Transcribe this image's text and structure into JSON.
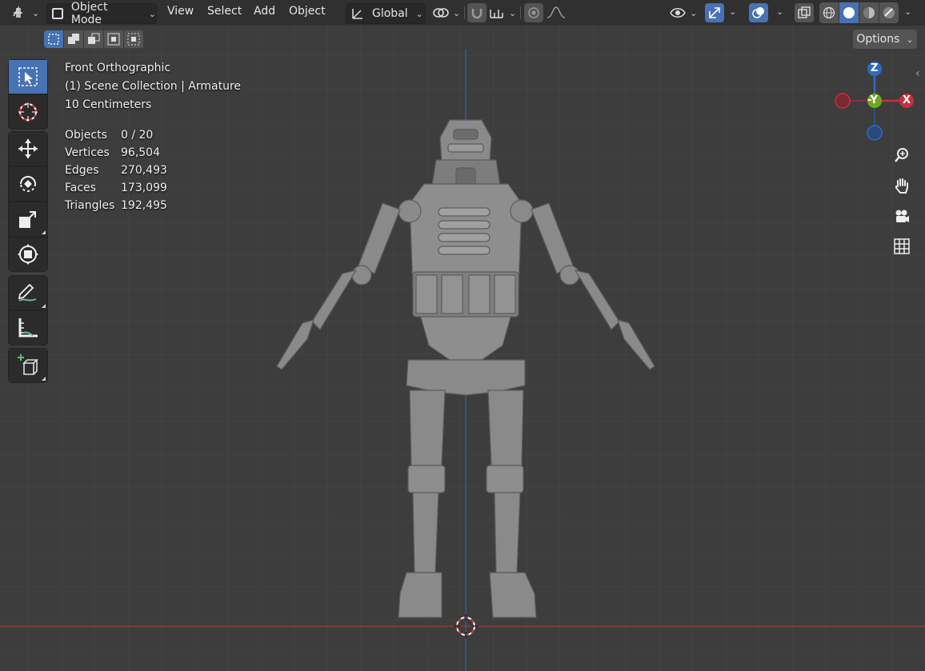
{
  "header": {
    "mode_label": "Object Mode",
    "menus": [
      "View",
      "Select",
      "Add",
      "Object"
    ],
    "transform_orientation": "Global",
    "options_label": "Options"
  },
  "viewport": {
    "view_name": "Front Orthographic",
    "collection": "(1) Scene Collection | Armature",
    "grid_scale": "10 Centimeters"
  },
  "stats": [
    {
      "label": "Objects",
      "value": "0 / 20"
    },
    {
      "label": "Vertices",
      "value": "96,504"
    },
    {
      "label": "Edges",
      "value": "270,493"
    },
    {
      "label": "Faces",
      "value": "173,099"
    },
    {
      "label": "Triangles",
      "value": "192,495"
    }
  ],
  "gizmo": {
    "z": "Z",
    "y": "-Y",
    "x": "X"
  },
  "toolbar": [
    "select-box",
    "cursor",
    "move",
    "rotate",
    "scale",
    "transform",
    "annotate",
    "measure",
    "add-cube"
  ],
  "colors": {
    "accent": "#4772b3",
    "x_axis": "#c6303d",
    "y_axis": "#6fa81f",
    "z_axis": "#2f6cbf"
  }
}
